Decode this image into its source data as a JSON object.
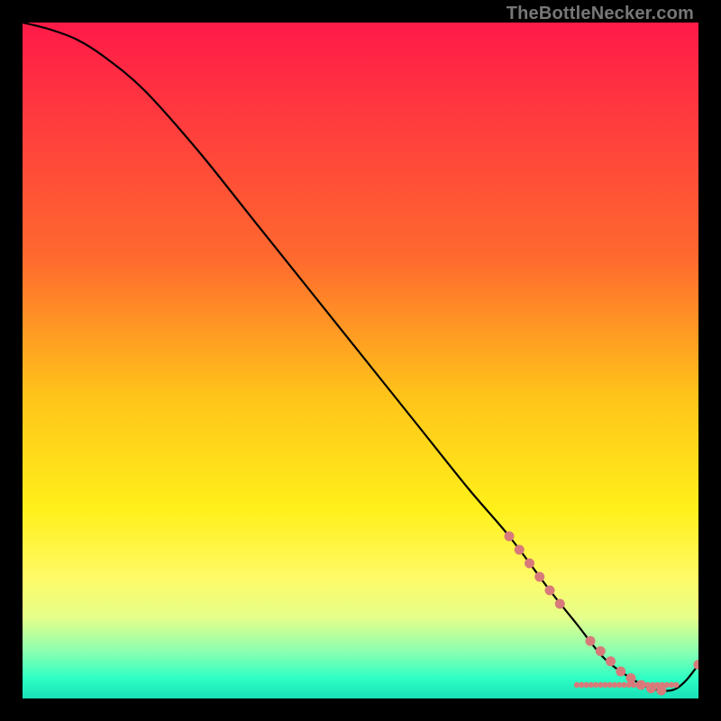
{
  "watermark": "TheBottleNecker.com",
  "chart_data": {
    "type": "line",
    "title": "",
    "xlabel": "",
    "ylabel": "",
    "xlim": [
      0,
      100
    ],
    "ylim": [
      0,
      100
    ],
    "grid": false,
    "legend": false,
    "gradient_stops": [
      {
        "offset": 0,
        "color": "#ff1a49"
      },
      {
        "offset": 0.35,
        "color": "#ff6a2e"
      },
      {
        "offset": 0.55,
        "color": "#ffc31a"
      },
      {
        "offset": 0.72,
        "color": "#fff01a"
      },
      {
        "offset": 0.82,
        "color": "#fffa66"
      },
      {
        "offset": 0.88,
        "color": "#e6ff8a"
      },
      {
        "offset": 0.93,
        "color": "#8cffb0"
      },
      {
        "offset": 0.97,
        "color": "#2effc4"
      },
      {
        "offset": 1.0,
        "color": "#18e0b8"
      }
    ],
    "series": [
      {
        "name": "bottleneck-curve",
        "color": "#000000",
        "x": [
          0,
          4,
          8,
          12,
          18,
          26,
          34,
          42,
          50,
          58,
          66,
          72,
          78,
          82,
          86,
          90,
          93,
          96,
          98,
          100
        ],
        "values": [
          100,
          99,
          97.5,
          95,
          90,
          81,
          71,
          61,
          51,
          41,
          31,
          24,
          16,
          11,
          6,
          3,
          1.5,
          1.2,
          2.5,
          5
        ]
      }
    ],
    "markers": [
      {
        "name": "highlight-points",
        "color": "#d87a7a",
        "radius": 5.5,
        "x": [
          72,
          73.5,
          75,
          76.5,
          78,
          79.5,
          84,
          85.5,
          87,
          88.5,
          90,
          91.5,
          93,
          94.5,
          100
        ],
        "values": [
          24,
          22,
          20,
          18,
          16,
          14,
          8.5,
          7,
          5.5,
          4,
          3,
          2,
          1.5,
          1.2,
          5
        ]
      },
      {
        "name": "dense-baseline-points",
        "color": "#d87a7a",
        "radius": 3.2,
        "x": [
          82,
          82.7,
          83.4,
          84.1,
          84.8,
          85.5,
          86.2,
          86.9,
          87.6,
          88.3,
          89,
          89.7,
          90.4,
          91.1,
          91.8,
          92.5,
          93.2,
          93.9,
          94.6,
          95.3,
          96,
          96.7
        ],
        "values": [
          2,
          2,
          2,
          2,
          2,
          2,
          2,
          2,
          2,
          2,
          2,
          2,
          2,
          2,
          2,
          2,
          2,
          2,
          2,
          2,
          2,
          2
        ]
      }
    ]
  }
}
